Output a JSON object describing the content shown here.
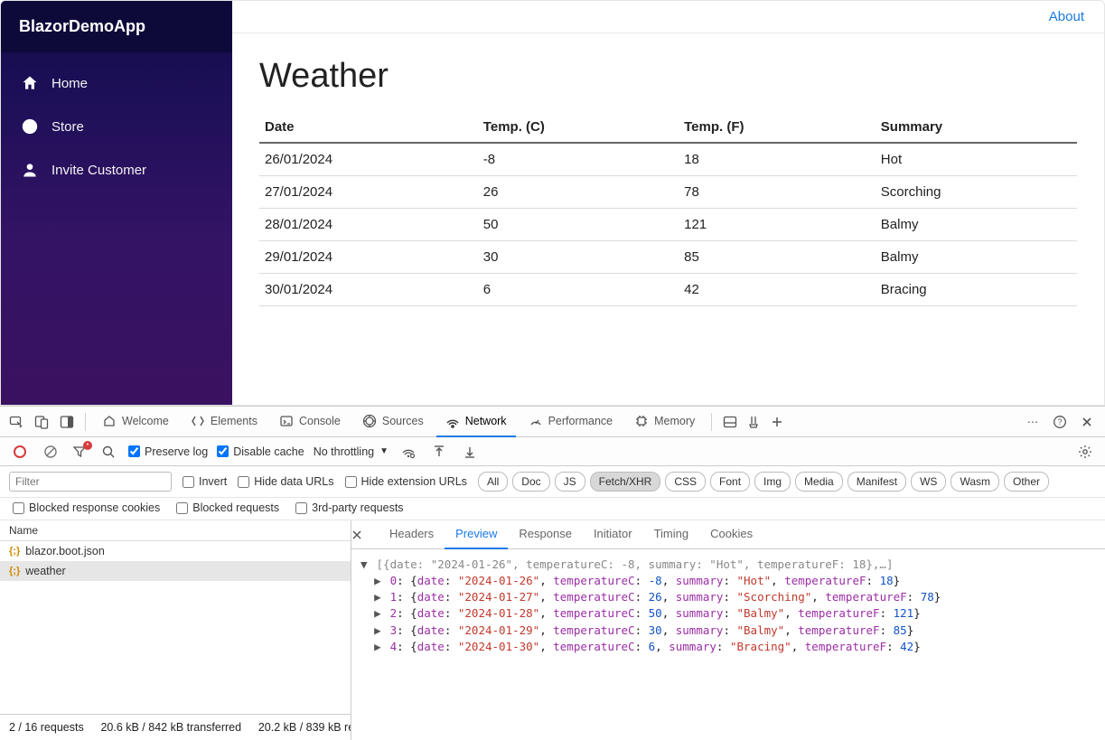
{
  "brand": "BlazorDemoApp",
  "nav": [
    {
      "label": "Home",
      "icon": "home-icon"
    },
    {
      "label": "Store",
      "icon": "globe-icon"
    },
    {
      "label": "Invite Customer",
      "icon": "person-icon"
    }
  ],
  "topbar": {
    "about": "About"
  },
  "page": {
    "title": "Weather",
    "headers": [
      "Date",
      "Temp. (C)",
      "Temp. (F)",
      "Summary"
    ],
    "rows": [
      {
        "date": "26/01/2024",
        "c": "-8",
        "f": "18",
        "summary": "Hot"
      },
      {
        "date": "27/01/2024",
        "c": "26",
        "f": "78",
        "summary": "Scorching"
      },
      {
        "date": "28/01/2024",
        "c": "50",
        "f": "121",
        "summary": "Balmy"
      },
      {
        "date": "29/01/2024",
        "c": "30",
        "f": "85",
        "summary": "Balmy"
      },
      {
        "date": "30/01/2024",
        "c": "6",
        "f": "42",
        "summary": "Bracing"
      }
    ]
  },
  "devtools": {
    "top_tabs": [
      "Welcome",
      "Elements",
      "Console",
      "Sources",
      "Network",
      "Performance",
      "Memory"
    ],
    "top_active": "Network",
    "toolbar": {
      "preserve_log": "Preserve log",
      "disable_cache": "Disable cache",
      "throttling": "No throttling"
    },
    "filters": {
      "placeholder": "Filter",
      "invert": "Invert",
      "hide_data": "Hide data URLs",
      "hide_ext": "Hide extension URLs",
      "types": [
        "All",
        "Doc",
        "JS",
        "Fetch/XHR",
        "CSS",
        "Font",
        "Img",
        "Media",
        "Manifest",
        "WS",
        "Wasm",
        "Other"
      ],
      "active_type": "Fetch/XHR"
    },
    "filters2": {
      "blocked_cookies": "Blocked response cookies",
      "blocked_requests": "Blocked requests",
      "third_party": "3rd-party requests"
    },
    "requests": {
      "header": "Name",
      "items": [
        {
          "label": "blazor.boot.json",
          "selected": false
        },
        {
          "label": "weather",
          "selected": true
        }
      ],
      "status": "2 / 16 requests  20.6 kB / 842 kB transferred  20.2 kB / 839 kB re"
    },
    "detail_tabs": [
      "Headers",
      "Preview",
      "Response",
      "Initiator",
      "Timing",
      "Cookies"
    ],
    "detail_active": "Preview",
    "preview": {
      "summary": "[{date: \"2024-01-26\", temperatureC: -8, summary: \"Hot\", temperatureF: 18},…]",
      "rows": [
        {
          "idx": "0",
          "date": "2024-01-26",
          "c": -8,
          "summary": "Hot",
          "f": 18
        },
        {
          "idx": "1",
          "date": "2024-01-27",
          "c": 26,
          "summary": "Scorching",
          "f": 78
        },
        {
          "idx": "2",
          "date": "2024-01-28",
          "c": 50,
          "summary": "Balmy",
          "f": 121
        },
        {
          "idx": "3",
          "date": "2024-01-29",
          "c": 30,
          "summary": "Balmy",
          "f": 85
        },
        {
          "idx": "4",
          "date": "2024-01-30",
          "c": 6,
          "summary": "Bracing",
          "f": 42
        }
      ]
    }
  }
}
